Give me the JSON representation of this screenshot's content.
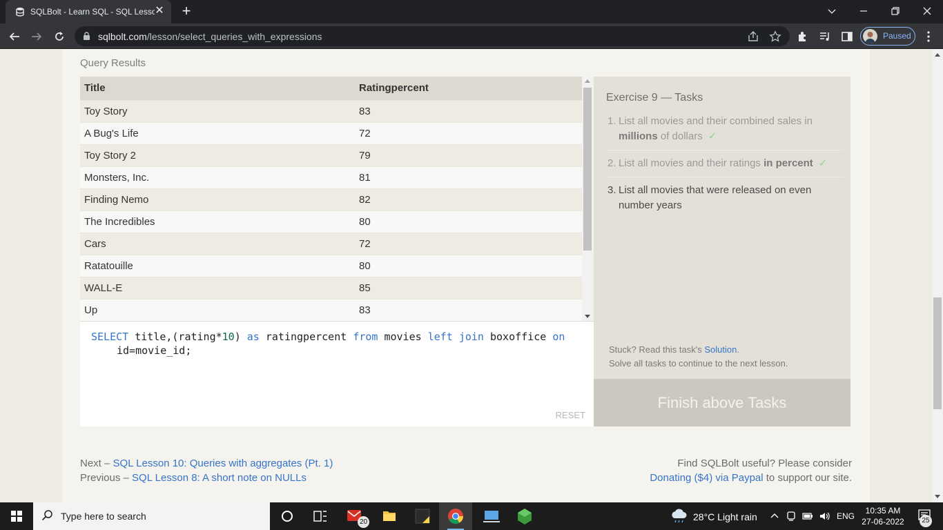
{
  "browser": {
    "tab_title": "SQLBolt - Learn SQL - SQL Lesson",
    "url_host": "sqlbolt.com",
    "url_path": "/lesson/select_queries_with_expressions",
    "profile_status": "Paused"
  },
  "page": {
    "results_label": "Query Results",
    "columns": [
      "Title",
      "Ratingpercent"
    ],
    "rows": [
      [
        "Toy Story",
        "83"
      ],
      [
        "A Bug's Life",
        "72"
      ],
      [
        "Toy Story 2",
        "79"
      ],
      [
        "Monsters, Inc.",
        "81"
      ],
      [
        "Finding Nemo",
        "82"
      ],
      [
        "The Incredibles",
        "80"
      ],
      [
        "Cars",
        "72"
      ],
      [
        "Ratatouille",
        "80"
      ],
      [
        "WALL-E",
        "85"
      ],
      [
        "Up",
        "83"
      ]
    ],
    "query": {
      "kw_select": "SELECT",
      "part1": " title,(rating*",
      "num": "10",
      "part2": ") ",
      "kw_as": "as",
      "part3": " ratingpercent ",
      "kw_from": "from",
      "part4": " movies ",
      "kw_left": "left",
      "kw_join": "join",
      "part5": " boxoffice ",
      "kw_on": "on",
      "line2": "id=movie_id;"
    },
    "reset_label": "RESET",
    "tasks": {
      "title": "Exercise 9 — Tasks",
      "items": [
        {
          "num": "1.",
          "pre": "List all movies and their combined sales in ",
          "bold": "millions",
          "post": " of dollars",
          "check": "✓"
        },
        {
          "num": "2.",
          "pre": "List all movies and their ratings ",
          "bold": "in percent",
          "post": "",
          "check": "✓"
        },
        {
          "num": "3.",
          "text": "List all movies that were released on even number years"
        }
      ],
      "stuck_pre": "Stuck? Read this task's ",
      "solution_link": "Solution",
      "stuck_post": ".",
      "solve_all": "Solve all tasks to continue to the next lesson.",
      "finish_button": "Finish above Tasks"
    },
    "footer": {
      "next_prefix": "Next – ",
      "next_link": "SQL Lesson 10: Queries with aggregates (Pt. 1)",
      "prev_prefix": "Previous – ",
      "prev_link": "SQL Lesson 8: A short note on NULLs",
      "useful": "Find SQLBolt useful? Please consider",
      "donate_link": "Donating ($4) via Paypal",
      "donate_post": " to support our site."
    }
  },
  "taskbar": {
    "search_placeholder": "Type here to search",
    "mail_badge": "20",
    "weather": "28°C  Light rain",
    "language": "ENG",
    "time": "10:35 AM",
    "date": "27-06-2022",
    "notification_count": "25"
  },
  "colors": {
    "accent_link": "#3574c8",
    "sql_keyword": "#3574c8",
    "check": "#8fd38f"
  }
}
